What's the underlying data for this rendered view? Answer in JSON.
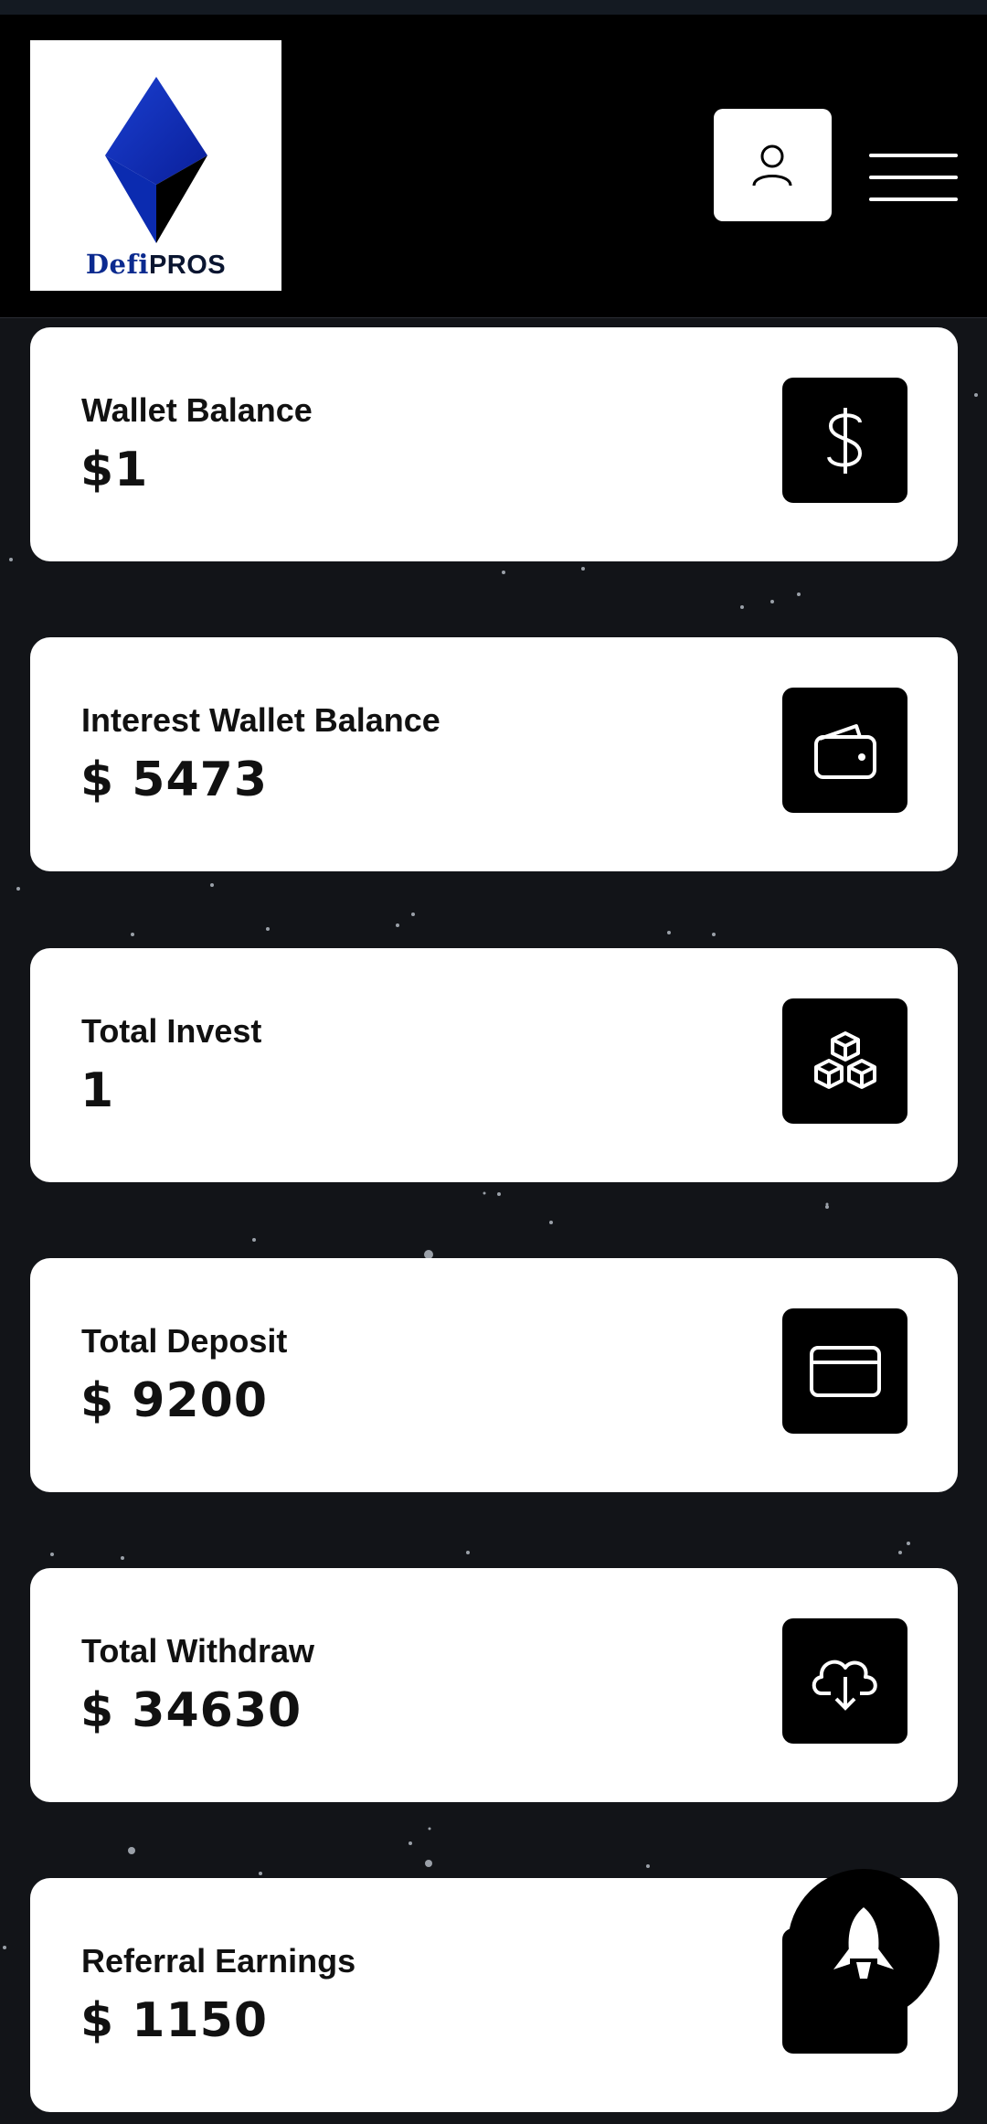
{
  "brand": {
    "name_part1": "Defi",
    "name_part2": "PROS"
  },
  "header": {
    "profile_icon": "user-icon",
    "menu_icon": "hamburger-menu-icon"
  },
  "cards": [
    {
      "label": "Wallet Balance",
      "value": "$1",
      "icon": "dollar-icon"
    },
    {
      "label": "Interest Wallet Balance",
      "value": "$ 5473",
      "icon": "wallet-icon"
    },
    {
      "label": "Total Invest",
      "value": "1",
      "icon": "cubes-icon"
    },
    {
      "label": "Total Deposit",
      "value": "$ 9200",
      "icon": "credit-card-icon"
    },
    {
      "label": "Total Withdraw",
      "value": "$ 34630",
      "icon": "cloud-download-icon"
    },
    {
      "label": "Referral Earnings",
      "value": "$ 1150",
      "icon": "referral-icon"
    }
  ],
  "floating_button": {
    "icon": "rocket-icon"
  }
}
